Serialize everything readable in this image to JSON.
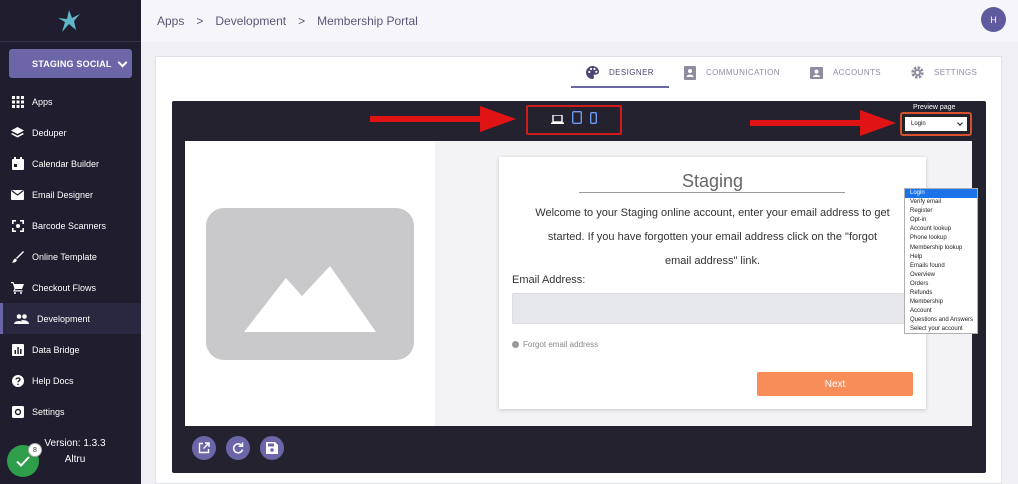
{
  "sidebar": {
    "account_label": "STAGING SOCIAL",
    "items": [
      {
        "label": "Apps",
        "icon": "grid-icon"
      },
      {
        "label": "Deduper",
        "icon": "layers-icon"
      },
      {
        "label": "Calendar Builder",
        "icon": "calendar-icon"
      },
      {
        "label": "Email Designer",
        "icon": "mail-icon"
      },
      {
        "label": "Barcode Scanners",
        "icon": "scan-icon"
      },
      {
        "label": "Online Template",
        "icon": "brush-icon"
      },
      {
        "label": "Checkout Flows",
        "icon": "cart-icon"
      },
      {
        "label": "Development",
        "icon": "people-icon"
      },
      {
        "label": "Data Bridge",
        "icon": "chart-icon"
      },
      {
        "label": "Help Docs",
        "icon": "help-icon"
      },
      {
        "label": "Settings",
        "icon": "gear-icon"
      }
    ],
    "version": "Version: 1.3.3",
    "org": "Altru",
    "badge_count": "8"
  },
  "header": {
    "breadcrumb": [
      "Apps",
      "Development",
      "Membership Portal"
    ],
    "avatar_initial": "H"
  },
  "tabs": [
    {
      "label": "DESIGNER",
      "icon": "palette-icon"
    },
    {
      "label": "COMMUNICATION",
      "icon": "contact-book-icon"
    },
    {
      "label": "ACCOUNTS",
      "icon": "account-card-icon"
    },
    {
      "label": "SETTINGS",
      "icon": "gear-icon"
    }
  ],
  "designer": {
    "preview_label": "Preview page",
    "preview_selected": "Login",
    "preview_options": [
      "Login",
      "Verify email",
      "Register",
      "Opt-in",
      "Account lookup",
      "Phone lookup",
      "Membership lookup",
      "Help",
      "Emails found",
      "Overview",
      "Orders",
      "Refunds",
      "Membership",
      "Account",
      "Questions and Answers",
      "Select your account"
    ]
  },
  "card": {
    "title": "Staging",
    "text": "Welcome to your Staging online account, enter your email address to get started. If you have forgotten your email address click on the \"forgot email address\" link.",
    "email_label": "Email Address:",
    "forgot_label": "Forgot email address",
    "next_label": "Next"
  },
  "colors": {
    "sidebar_bg": "#1f1d2e",
    "accent": "#6b66a8",
    "next_button": "#f98d5a",
    "highlight_red": "#d11b1b"
  }
}
